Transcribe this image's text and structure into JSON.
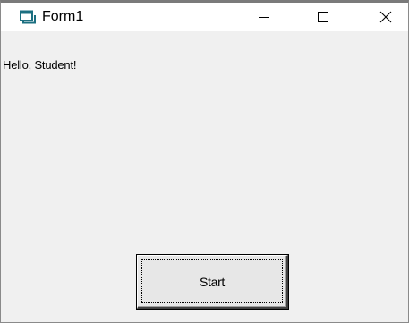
{
  "window": {
    "title": "Form1",
    "icon": "form-window-icon",
    "controls": {
      "minimize": "minimize-icon",
      "maximize": "maximize-icon",
      "close": "close-icon"
    }
  },
  "form": {
    "greeting_label": "Hello, Student!",
    "start_button_label": "Start"
  },
  "colors": {
    "titlebar": "#ffffff",
    "client_background": "#f0f0f0",
    "icon_accent": "#1b6f80"
  }
}
